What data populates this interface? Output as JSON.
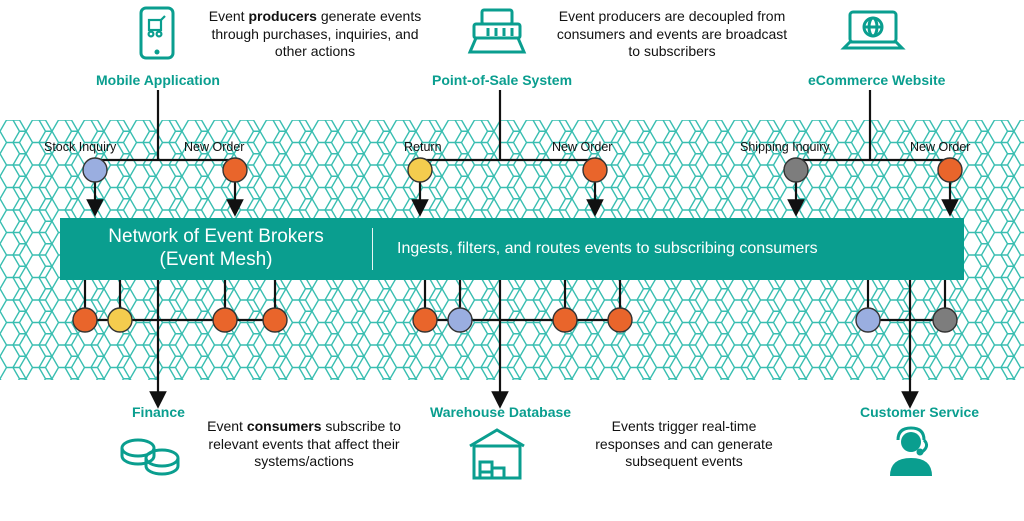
{
  "desc_top_left": "Event producers generate events through purchases, inquiries, and other actions",
  "desc_top_right": "Event producers are decoupled from consumers and events are broadcast to subscribers",
  "desc_bot_left": "Event consumers subscribe to relevant events that affect their systems/actions",
  "desc_bot_right": "Events trigger real-time responses and can generate subsequent events",
  "producers": {
    "mobile": "Mobile Application",
    "pos": "Point-of-Sale System",
    "ecom": "eCommerce Website"
  },
  "consumers": {
    "finance": "Finance",
    "warehouse": "Warehouse Database",
    "customer": "Customer Service"
  },
  "mesh": {
    "title_l1": "Network of Event Brokers",
    "title_l2": "(Event Mesh)",
    "subtitle": "Ingests, filters, and routes events to subscribing consumers"
  },
  "events": {
    "stock_inquiry": "Stock Inquiry",
    "new_order": "New Order",
    "return": "Return",
    "shipping_inquiry": "Shipping Inquiry"
  },
  "colors": {
    "teal": "#0a9e8f",
    "orange": "#e9652b",
    "yellow": "#f4cc4e",
    "blue": "#9aaee0",
    "grey": "#7d7d7d"
  }
}
